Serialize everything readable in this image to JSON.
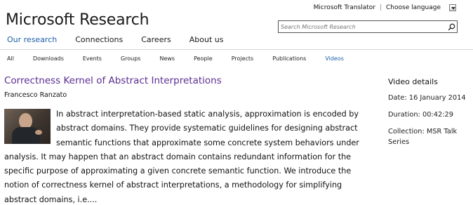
{
  "header": {
    "brand": "Microsoft Research",
    "translator": "Microsoft Translator",
    "separator": "|",
    "language_label": "Choose language",
    "search_placeholder": "Search Microsoft Research"
  },
  "main_nav": [
    "Our research",
    "Connections",
    "Careers",
    "About us"
  ],
  "sub_nav": [
    "All",
    "Downloads",
    "Events",
    "Groups",
    "News",
    "People",
    "Projects",
    "Publications",
    "Videos"
  ],
  "video": {
    "title": "Correctness Kernel of Abstract Interpretations",
    "author": "Francesco Ranzato",
    "description": "In abstract interpretation-based static analysis, approximation is encoded by abstract domains. They provide systematic guidelines for designing abstract semantic functions that approximate some concrete system behaviors under analysis. It may happen that an abstract domain contains redundant information for the specific purpose of approximating a given concrete semantic function. We introduce the notion of correctness kernel of abstract interpretations, a methodology for simplifying abstract domains, i.e...."
  },
  "details": {
    "heading": "Video details",
    "date": "Date: 16 January 2014",
    "duration": "Duration: 00:42:29",
    "collection": "Collection: MSR Talk Series"
  },
  "colors": {
    "accent_link": "#1e5fa8",
    "title_purple": "#5c2d91"
  },
  "icons": {
    "search": "magnifier-icon",
    "dropdown": "dropdown-arrow-icon",
    "thumbnail": "speaker-thumbnail"
  }
}
